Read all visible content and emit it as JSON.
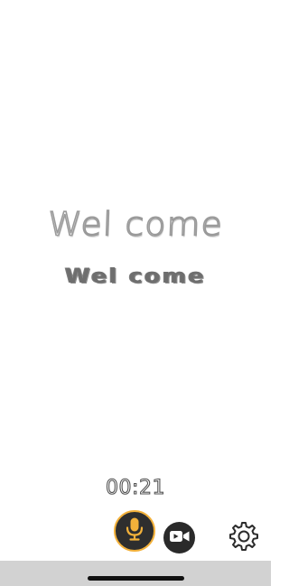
{
  "welcome": {
    "title_outline": "Wel come",
    "title_bold": "Wel come"
  },
  "recorder": {
    "elapsed_time": "00:21"
  },
  "controls": {
    "mic_icon": "microphone-icon",
    "video_icon": "video-camera-icon",
    "settings_icon": "gear-icon"
  },
  "colors": {
    "accent": "#f3b13a",
    "button_dark": "#2a2a2a",
    "home_bar": "#d2d2d2"
  }
}
